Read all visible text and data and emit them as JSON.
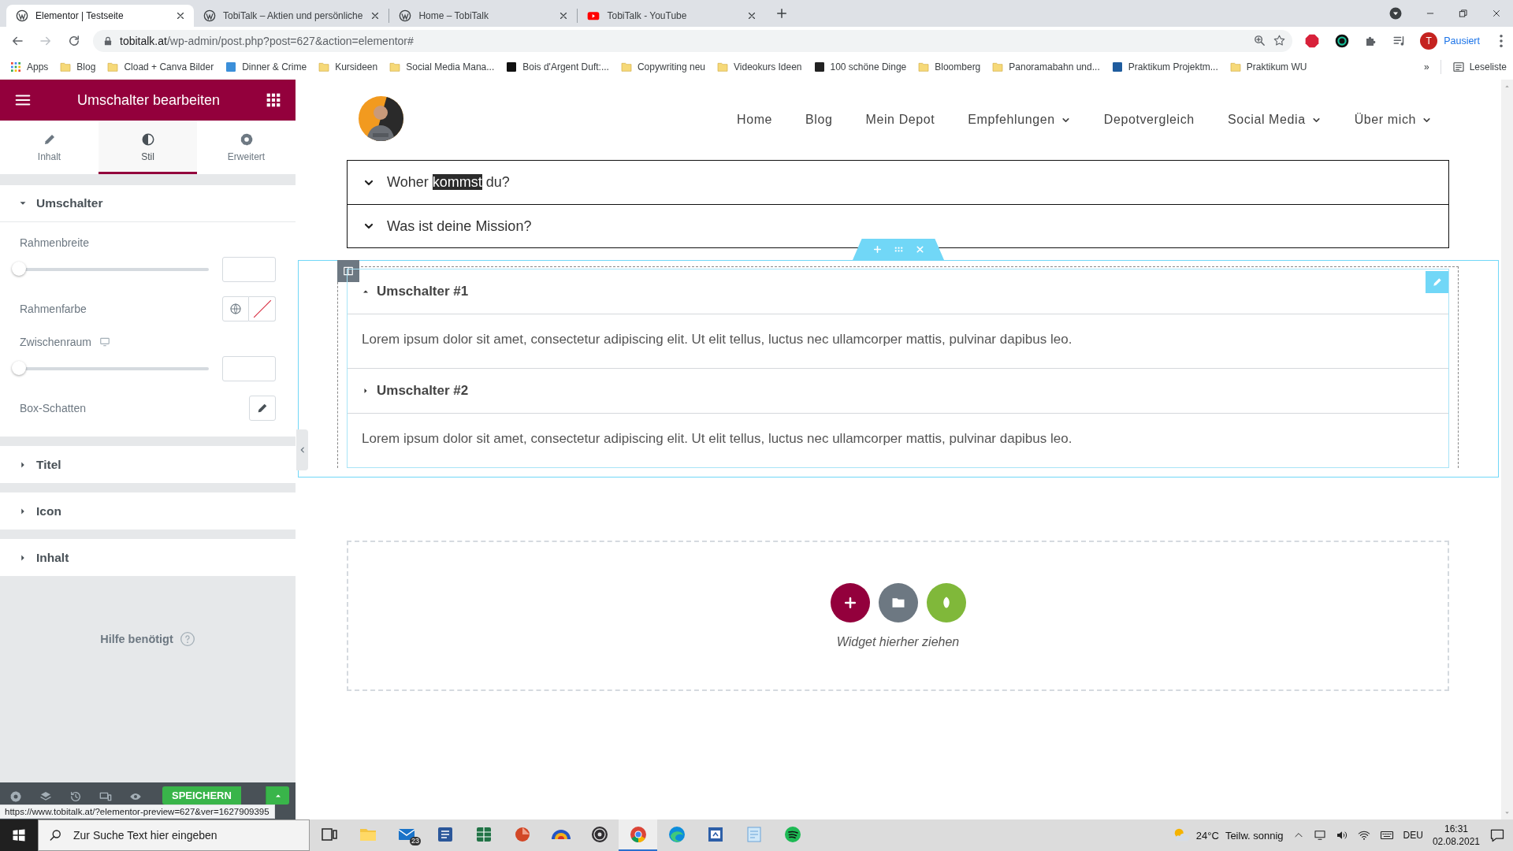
{
  "browser": {
    "tabs": [
      {
        "title": "Elementor | Testseite",
        "kind": "wordpress",
        "selected": true
      },
      {
        "title": "TobiTalk – Aktien und persönliche",
        "kind": "wordpress",
        "selected": false
      },
      {
        "title": "Home – TobiTalk",
        "kind": "wordpress",
        "selected": false
      },
      {
        "title": "TobiTalk - YouTube",
        "kind": "youtube",
        "selected": false
      }
    ],
    "address": {
      "host": "tobitalk.at",
      "path": "/wp-admin/post.php?post=627&action=elementor#"
    },
    "profile": {
      "initial": "T",
      "label": "Pausiert"
    },
    "bookmarks": [
      {
        "label": "Apps",
        "kind": "apps"
      },
      {
        "label": "Blog",
        "kind": "folder"
      },
      {
        "label": "Cload + Canva Bilder",
        "kind": "folder"
      },
      {
        "label": "Dinner & Crime",
        "kind": "site",
        "color": "#3b8fd9"
      },
      {
        "label": "Kursideen",
        "kind": "folder"
      },
      {
        "label": "Social Media Mana...",
        "kind": "folder"
      },
      {
        "label": "Bois d'Argent Duft:...",
        "kind": "site",
        "color": "#111111"
      },
      {
        "label": "Copywriting neu",
        "kind": "folder"
      },
      {
        "label": "Videokurs Ideen",
        "kind": "folder"
      },
      {
        "label": "100 schöne Dinge",
        "kind": "site",
        "color": "#222222"
      },
      {
        "label": "Bloomberg",
        "kind": "folder"
      },
      {
        "label": "Panoramabahn und...",
        "kind": "folder"
      },
      {
        "label": "Praktikum Projektm...",
        "kind": "site",
        "color": "#1f5c9e"
      },
      {
        "label": "Praktikum WU",
        "kind": "folder"
      }
    ],
    "bookmarks_more": "»",
    "reading_list": "Leseliste"
  },
  "editor": {
    "title": "Umschalter bearbeiten",
    "tabs": [
      {
        "label": "Inhalt",
        "kind": "pencil",
        "selected": false
      },
      {
        "label": "Stil",
        "kind": "contrast",
        "selected": true
      },
      {
        "label": "Erweitert",
        "kind": "gear",
        "selected": false
      }
    ],
    "sections": [
      {
        "title": "Umschalter",
        "expanded": true,
        "controls": [
          {
            "kind": "slider",
            "label": "Rahmenbreite",
            "level": 0,
            "responsive": false
          },
          {
            "kind": "color",
            "label": "Rahmenfarbe"
          },
          {
            "kind": "slider",
            "label": "Zwischenraum",
            "level": 0,
            "responsive": true
          },
          {
            "kind": "popover",
            "label": "Box-Schatten"
          }
        ]
      },
      {
        "title": "Titel",
        "expanded": false
      },
      {
        "title": "Icon",
        "expanded": false
      },
      {
        "title": "Inhalt",
        "expanded": false
      }
    ],
    "help": "Hilfe benötigt",
    "save_button": "SPEICHERN"
  },
  "status_url": "https://www.tobitalk.at/?elementor-preview=627&ver=1627909395",
  "preview": {
    "nav": [
      {
        "label": "Home",
        "dropdown": false
      },
      {
        "label": "Blog",
        "dropdown": false
      },
      {
        "label": "Mein Depot",
        "dropdown": false
      },
      {
        "label": "Empfehlungen",
        "dropdown": true
      },
      {
        "label": "Depotvergleich",
        "dropdown": false
      },
      {
        "label": "Social Media",
        "dropdown": true
      },
      {
        "label": "Über mich",
        "dropdown": true
      }
    ],
    "accordion": [
      {
        "title_parts": [
          {
            "text": "Woher ",
            "highlighted": false
          },
          {
            "text": "kommst",
            "highlighted": true
          },
          {
            "text": " du?",
            "highlighted": false
          }
        ]
      },
      {
        "title_parts": [
          {
            "text": "Was ist deine Mission?",
            "highlighted": false
          }
        ]
      }
    ],
    "toggle": [
      {
        "title": "Umschalter #1",
        "expanded": true,
        "content": "Lorem ipsum dolor sit amet, consectetur adipiscing elit. Ut elit tellus, luctus nec ullamcorper mattis, pulvinar dapibus leo."
      },
      {
        "title": "Umschalter #2",
        "expanded": false,
        "content": "Lorem ipsum dolor sit amet, consectetur adipiscing elit. Ut elit tellus, luctus nec ullamcorper mattis, pulvinar dapibus leo."
      }
    ],
    "drop_zone": {
      "label": "Widget hierher ziehen"
    }
  },
  "taskbar": {
    "search_placeholder": "Zur Suche Text hier eingeben",
    "apps": [
      {
        "kind": "taskview",
        "active": false
      },
      {
        "kind": "explorer",
        "active": false
      },
      {
        "kind": "mail",
        "active": false,
        "badge": "23"
      },
      {
        "kind": "word",
        "active": false
      },
      {
        "kind": "excel",
        "active": false
      },
      {
        "kind": "powerpoint",
        "active": false
      },
      {
        "kind": "arc",
        "active": false
      },
      {
        "kind": "obs",
        "active": false
      },
      {
        "kind": "chrome",
        "active": true
      },
      {
        "kind": "edge",
        "active": false
      },
      {
        "kind": "window",
        "active": false
      },
      {
        "kind": "notepad",
        "active": false
      },
      {
        "kind": "spotify",
        "active": false
      }
    ],
    "temperature": "24°C",
    "weather": "Teilw. sonnig",
    "language": "DEU",
    "time": "16:31",
    "date": "02.08.2021"
  }
}
